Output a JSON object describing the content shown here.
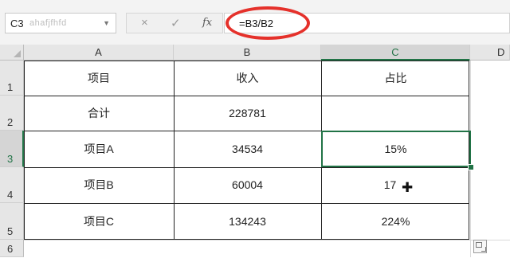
{
  "name_box": {
    "ref": "C3",
    "ghost": "ahafjfhfd"
  },
  "formula_bar": {
    "cancel_icon": "×",
    "enter_icon": "✓",
    "fx_label": "fx",
    "formula": "=B3/B2"
  },
  "columns": [
    "A",
    "B",
    "C",
    "D"
  ],
  "rows": [
    "1",
    "2",
    "3",
    "4",
    "5",
    "6"
  ],
  "table": {
    "header": [
      "项目",
      "收入",
      "占比"
    ],
    "rows": [
      [
        "合计",
        "228781",
        ""
      ],
      [
        "项目A",
        "34534",
        "15%"
      ],
      [
        "项目B",
        "60004",
        "17"
      ],
      [
        "项目C",
        "134243",
        "224%"
      ]
    ]
  },
  "selected_cell": "C3",
  "colors": {
    "accent": "#217346",
    "annotation": "#e5312b"
  }
}
